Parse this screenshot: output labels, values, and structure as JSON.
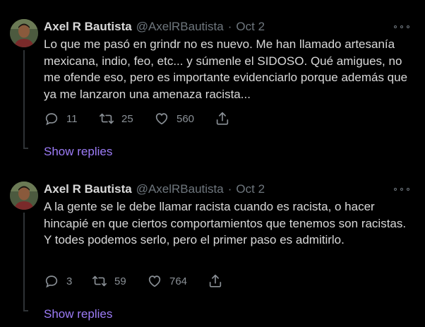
{
  "tweets": [
    {
      "name": "Axel R Bautista",
      "handle": "@AxelRBautista",
      "separator": "·",
      "date": "Oct 2",
      "text": "Lo que me pasó en grindr no es nuevo. Me han llamado artesanía mexicana, indio, feo, etc... y súmenle el SIDOSO. Qué amigues, no me ofende eso, pero es importante evidenciarlo porque además que ya me lanzaron una amenaza racista...",
      "replies": "11",
      "retweets": "25",
      "likes": "560",
      "show_replies": "Show replies"
    },
    {
      "name": "Axel R Bautista",
      "handle": "@AxelRBautista",
      "separator": "·",
      "date": "Oct 2",
      "text": "A la gente se le debe llamar racista cuando es racista, o hacer hincapié en que ciertos comportamientos que tenemos son racistas. Y todes podemos serlo, pero el primer paso es admitirlo.",
      "replies": "3",
      "retweets": "59",
      "likes": "764",
      "show_replies": "Show replies"
    }
  ],
  "colors": {
    "background": "#000000",
    "text": "#d9d9d9",
    "muted": "#6e767d",
    "link": "#9d7cf8",
    "line": "#2f3336"
  },
  "icons": [
    "avatar",
    "more-icon",
    "reply-icon",
    "retweet-icon",
    "like-icon",
    "share-icon"
  ]
}
